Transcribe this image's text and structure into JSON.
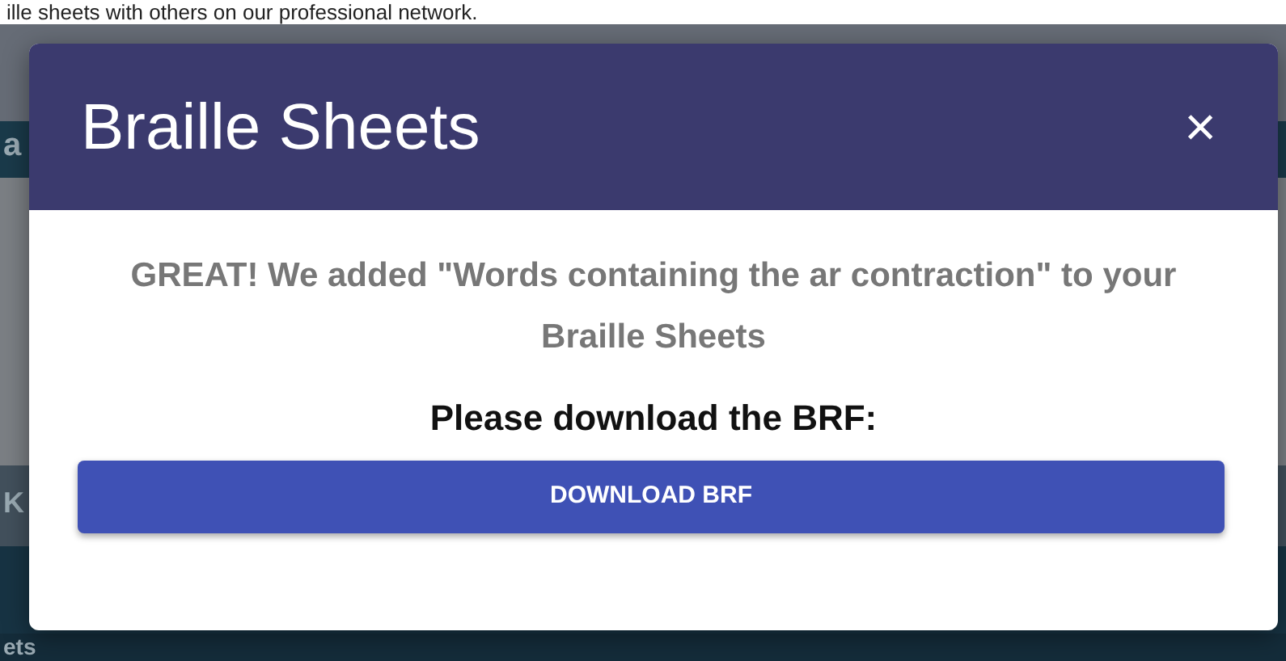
{
  "background": {
    "intro_text": "ille sheets with others on our professional network.",
    "fragments": [
      "a",
      "K",
      "ets"
    ]
  },
  "modal": {
    "title": "Braille Sheets",
    "close": "×",
    "message": "GREAT! We added \"Words containing the ar contraction\" to your Braille Sheets",
    "prompt": "Please download the BRF:",
    "button": "DOWNLOAD BRF"
  }
}
